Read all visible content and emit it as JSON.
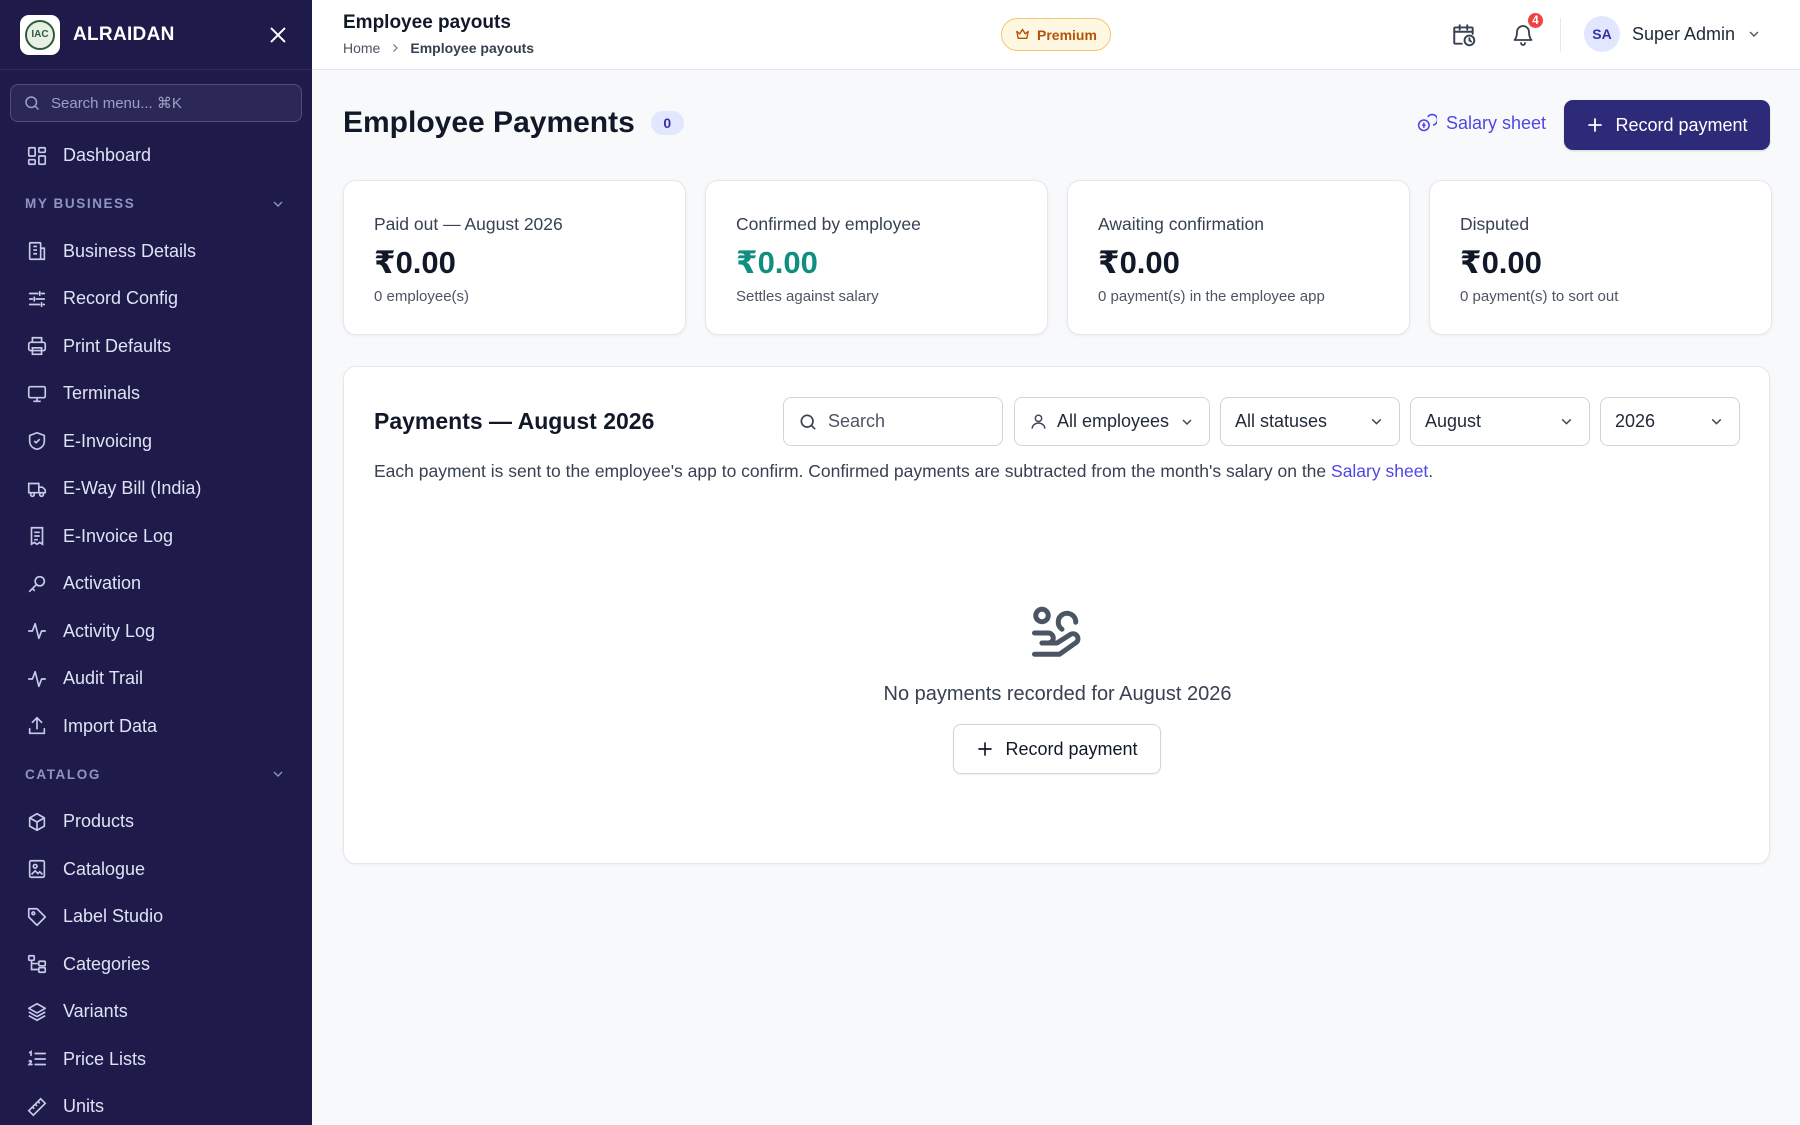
{
  "sidebar": {
    "brand": "ALRAIDAN",
    "logo_text": "IAC",
    "search_placeholder": "Search menu... ⌘K",
    "items": [
      {
        "label": "Dashboard",
        "icon": "dashboard-icon"
      },
      {
        "label": "Business Details",
        "icon": "building-icon"
      },
      {
        "label": "Record Config",
        "icon": "sliders-icon"
      },
      {
        "label": "Print Defaults",
        "icon": "printer-icon"
      },
      {
        "label": "Terminals",
        "icon": "monitor-icon"
      },
      {
        "label": "E-Invoicing",
        "icon": "shield-check-icon"
      },
      {
        "label": "E-Way Bill (India)",
        "icon": "truck-icon"
      },
      {
        "label": "E-Invoice Log",
        "icon": "receipt-icon"
      },
      {
        "label": "Activation",
        "icon": "key-icon"
      },
      {
        "label": "Activity Log",
        "icon": "activity-icon"
      },
      {
        "label": "Audit Trail",
        "icon": "activity-icon"
      },
      {
        "label": "Import Data",
        "icon": "upload-icon"
      },
      {
        "label": "Products",
        "icon": "box-icon"
      },
      {
        "label": "Catalogue",
        "icon": "image-book-icon"
      },
      {
        "label": "Label Studio",
        "icon": "tag-icon"
      },
      {
        "label": "Categories",
        "icon": "tree-icon"
      },
      {
        "label": "Variants",
        "icon": "layers-icon"
      },
      {
        "label": "Price Lists",
        "icon": "list-ordered-icon"
      },
      {
        "label": "Units",
        "icon": "ruler-icon"
      }
    ],
    "sections": {
      "my_business": "MY BUSINESS",
      "catalog": "CATALOG"
    }
  },
  "topbar": {
    "title": "Employee payouts",
    "breadcrumb": {
      "home": "Home",
      "current": "Employee payouts"
    },
    "premium_label": "Premium",
    "notification_count": "4",
    "user": {
      "initials": "SA",
      "name": "Super Admin"
    }
  },
  "page": {
    "title": "Employee Payments",
    "count": "0",
    "salary_sheet_label": "Salary sheet",
    "record_payment_label": "Record payment"
  },
  "stats": [
    {
      "label": "Paid out — August 2026",
      "value": "₹0.00",
      "sub": "0 employee(s)"
    },
    {
      "label": "Confirmed by employee",
      "value": "₹0.00",
      "sub": "Settles against salary"
    },
    {
      "label": "Awaiting confirmation",
      "value": "₹0.00",
      "sub": "0 payment(s) in the employee app"
    },
    {
      "label": "Disputed",
      "value": "₹0.00",
      "sub": "0 payment(s) to sort out"
    }
  ],
  "payments": {
    "title": "Payments — August 2026",
    "search_placeholder": "Search",
    "filters": {
      "employee": "All employees",
      "status": "All statuses",
      "month": "August",
      "year": "2026"
    },
    "helper_text": "Each payment is sent to the employee's app to confirm. Confirmed payments are subtracted from the month's salary on the ",
    "helper_link": "Salary sheet",
    "helper_end": ".",
    "empty_text": "No payments recorded for August 2026",
    "empty_button": "Record payment"
  },
  "colors": {
    "sidebar_bg": "#1e1b4b",
    "primary": "#2e2a7a",
    "accent": "#4f46e5",
    "confirmed_green": "#0f8f80",
    "badge_red": "#ef4444",
    "premium_amber": "#b45309"
  }
}
